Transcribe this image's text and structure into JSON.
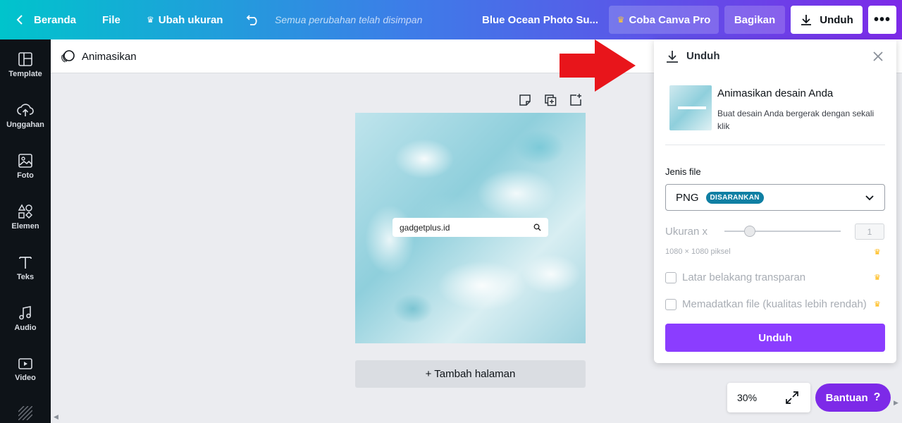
{
  "topbar": {
    "back_label": "Beranda",
    "file_label": "File",
    "resize_label": "Ubah ukuran",
    "saved_status": "Semua perubahan telah disimpan",
    "doc_title": "Blue Ocean Photo Su...",
    "pro_label": "Coba Canva Pro",
    "share_label": "Bagikan",
    "download_label": "Unduh"
  },
  "sidebar": {
    "items": [
      {
        "label": "Template",
        "icon": "template-icon"
      },
      {
        "label": "Unggahan",
        "icon": "upload-icon"
      },
      {
        "label": "Foto",
        "icon": "photo-icon"
      },
      {
        "label": "Elemen",
        "icon": "elements-icon"
      },
      {
        "label": "Teks",
        "icon": "text-icon"
      },
      {
        "label": "Audio",
        "icon": "audio-icon"
      },
      {
        "label": "Video",
        "icon": "video-icon"
      }
    ]
  },
  "subbar": {
    "animate_label": "Animasikan"
  },
  "canvas": {
    "search_text": "gadgetplus.id",
    "add_page_label": "+ Tambah halaman"
  },
  "download_panel": {
    "title": "Unduh",
    "animate_title": "Animasikan desain Anda",
    "animate_desc": "Buat desain Anda bergerak dengan sekali klik",
    "file_type_label": "Jenis file",
    "file_type_value": "PNG",
    "recommended_badge": "DISARANKAN",
    "size_label": "Ukuran x",
    "size_value": "1",
    "size_slider_fraction": 0.22,
    "dimensions": "1080 × 1080 piksel",
    "transparent_label": "Latar belakang transparan",
    "compress_label": "Memadatkan file (kualitas lebih rendah)",
    "download_button": "Unduh"
  },
  "bottom": {
    "zoom": "30%",
    "help_label": "Bantuan",
    "help_symbol": "?"
  },
  "colors": {
    "accent": "#8b3dff",
    "help_button": "#7d2ae8",
    "badge": "#0f7fa3",
    "arrow": "#e8151b"
  }
}
